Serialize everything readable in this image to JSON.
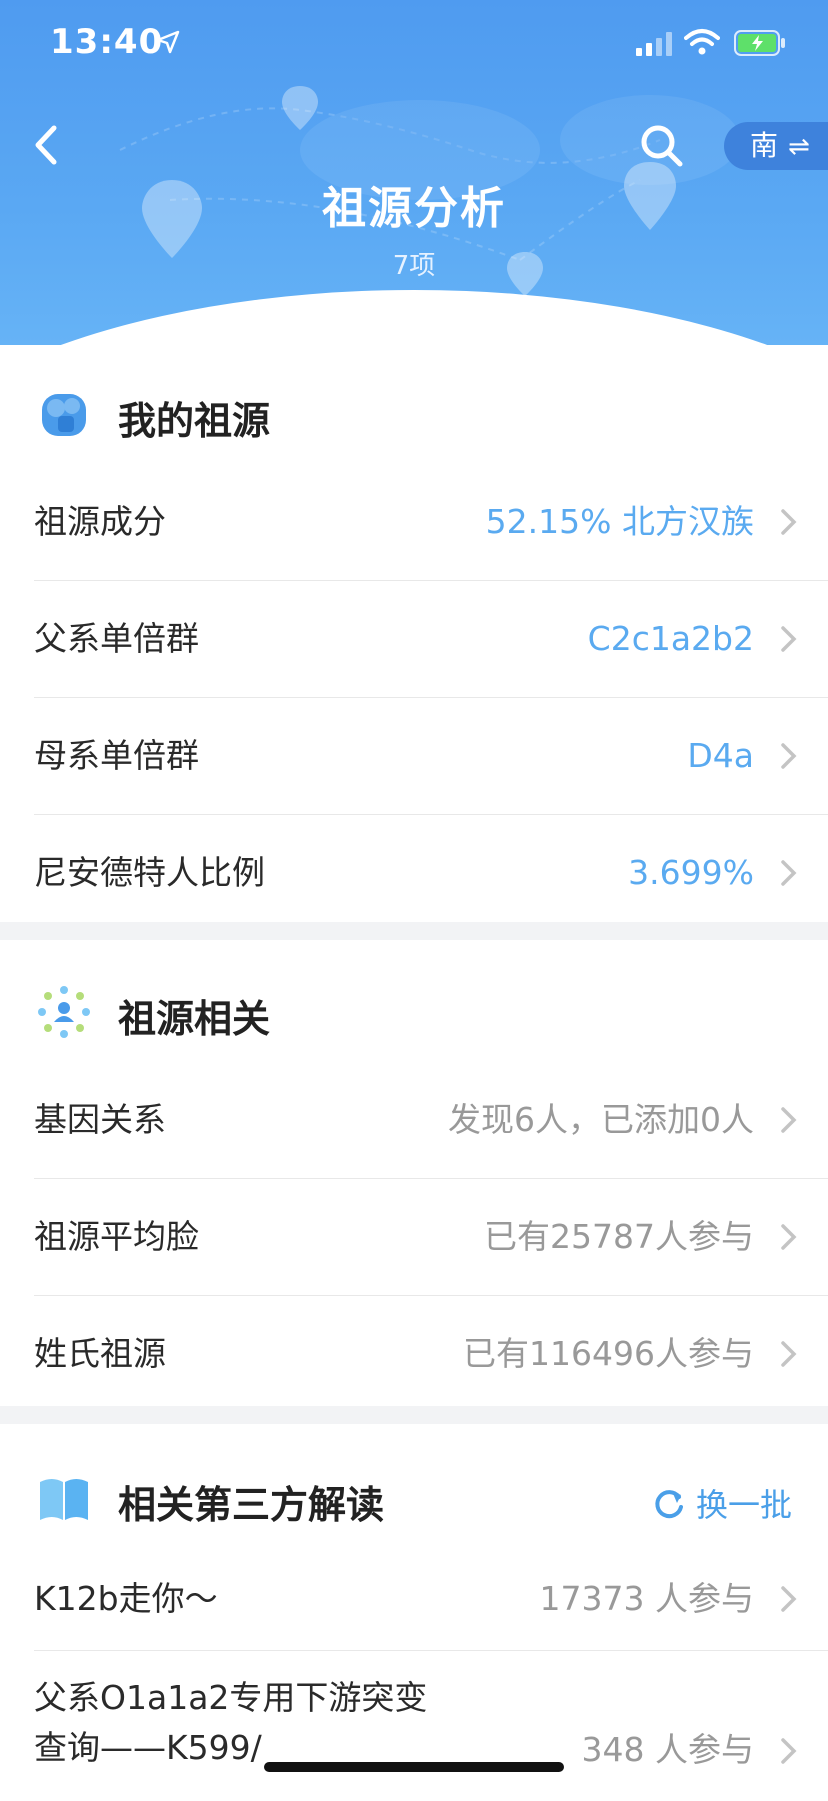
{
  "status_bar": {
    "time": "13:40"
  },
  "header": {
    "title": "祖源分析",
    "subtitle": "7项",
    "region_label": "南",
    "region_swap_icon": "⇌"
  },
  "my_ancestry": {
    "title": "我的祖源",
    "rows": [
      {
        "label": "祖源成分",
        "value": "52.15% 北方汉族"
      },
      {
        "label": "父系单倍群",
        "value": "C2c1a2b2"
      },
      {
        "label": "母系单倍群",
        "value": "D4a"
      },
      {
        "label": "尼安德特人比例",
        "value": "3.699%"
      }
    ]
  },
  "ancestry_related": {
    "title": "祖源相关",
    "rows": [
      {
        "label": "基因关系",
        "value": "发现6人，已添加0人"
      },
      {
        "label": "祖源平均脸",
        "value": "已有25787人参与"
      },
      {
        "label": "姓氏祖源",
        "value": "已有116496人参与"
      }
    ]
  },
  "third_party": {
    "title": "相关第三方解读",
    "refresh_label": "换一批",
    "rows": [
      {
        "label": "K12b走你～",
        "value": "17373 人参与"
      },
      {
        "label": "父系O1a1a2专用下游突变查询——K599/",
        "value": "348 人参与"
      }
    ]
  },
  "colors": {
    "header_blue": "#4f9bf0",
    "value_blue": "#5aaaf0",
    "value_gray": "#999999"
  }
}
